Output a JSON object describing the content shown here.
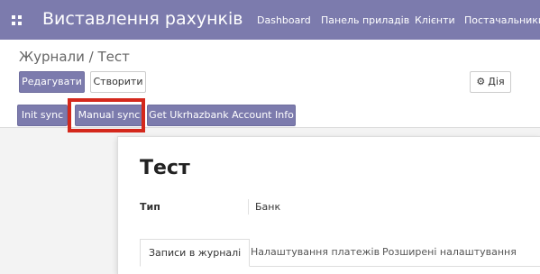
{
  "topbar": {
    "app_title": "Виставлення рахунків",
    "nav": [
      "Dashboard",
      "Панель приладів",
      "Клієнти",
      "Постачальники"
    ]
  },
  "breadcrumb": "Журнали / Тест",
  "toolbar": {
    "edit_label": "Редагувати",
    "create_label": "Створити",
    "action_label": "Дія",
    "action_icon": "gear-icon"
  },
  "sync_buttons": {
    "init_sync": "Init sync",
    "manual_sync": "Manual sync",
    "ukrhazbank_info": "Get Ukrhazbank Account Info"
  },
  "highlight_color": "#d4281c",
  "record": {
    "title": "Тест",
    "type_label": "Тип",
    "type_value": "Банк"
  },
  "tabs": [
    "Записи в журналі",
    "Налаштування платежів",
    "Розширені налаштування"
  ],
  "colors": {
    "brand": "#7c7bad"
  }
}
